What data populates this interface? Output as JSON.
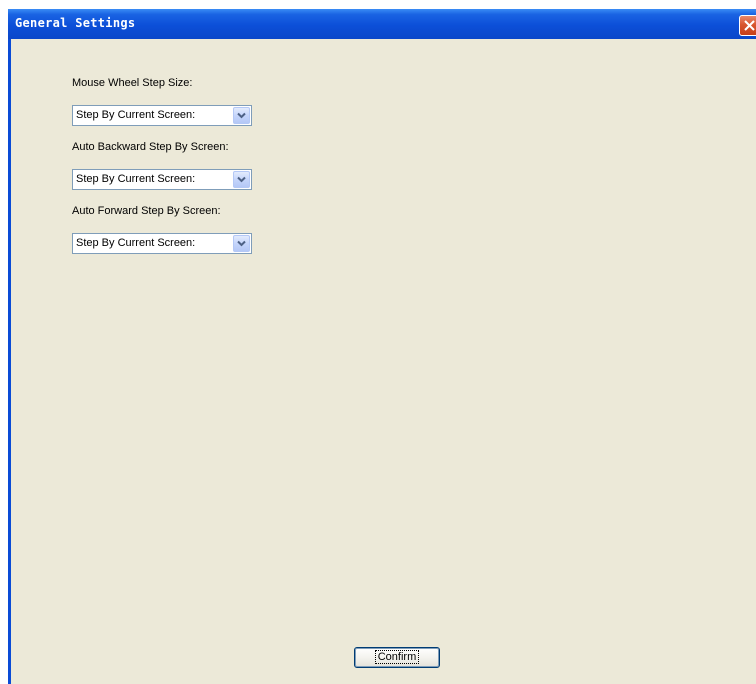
{
  "window": {
    "title": "General Settings"
  },
  "settings": [
    {
      "label": "Mouse Wheel Step Size:",
      "value": "Step By Current Screen:"
    },
    {
      "label": "Auto Backward Step By Screen:",
      "value": "Step By Current Screen:"
    },
    {
      "label": "Auto Forward Step By Screen:",
      "value": "Step By Current Screen:"
    }
  ],
  "footer": {
    "confirm_label": "Confirm"
  },
  "icons": {
    "close": "close-icon",
    "dropdown": "chevron-down-icon"
  },
  "colors": {
    "titlebar": "#0c4fd8",
    "client_background": "#ece9d8",
    "close_button": "#d8552e",
    "combo_border": "#7f9db9"
  }
}
